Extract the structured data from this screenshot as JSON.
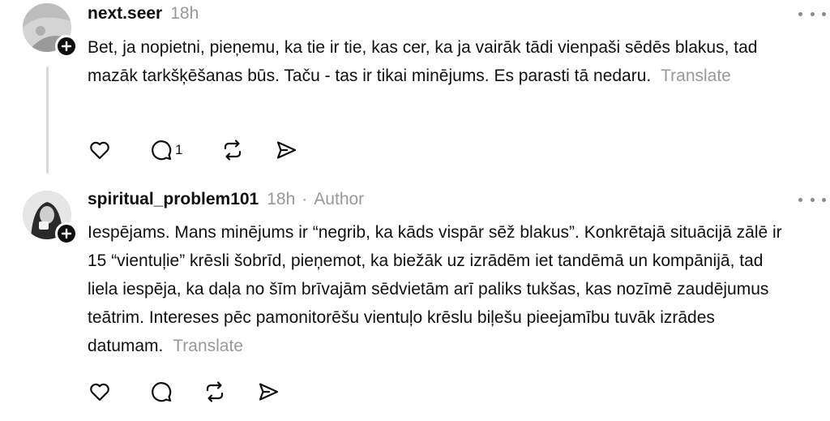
{
  "posts": [
    {
      "username": "next.seer",
      "time": "18h",
      "author_label": "",
      "text": "Bet, ja nopietni, pieņemu, ka tie ir tie, kas cer, ka ja vairāk tādi vienpaši sēdēs blakus, tad mazāk tarkšķēšanas būs. Taču - tas ir tikai minējums. Es parasti tā nedaru.",
      "translate_label": "Translate",
      "reply_count": "1",
      "icons": [
        "heart-icon",
        "comment-icon",
        "repost-icon",
        "share-icon"
      ]
    },
    {
      "username": "spiritual_problem101",
      "time": "18h",
      "author_label": "Author",
      "text": "Iespējams. Mans minējums ir “negrib, ka kāds vispār sēž blakus”. Konkrētajā situācijā zālē ir 15 “vientuļie” krēsli šobrīd, pieņemot, ka biežāk uz izrādēm iet tandēmā un kompānijā, tad liela iespēja, ka daļa no šīm brīvajām sēdvietām arī paliks tukšas, kas nozīmē zaudējumus teātrim. Intereses pēc pamonitorēšu vientuļo krēslu biļešu pieejamību tuvāk izrādes datumam.",
      "translate_label": "Translate",
      "reply_count": "",
      "icons": [
        "heart-icon",
        "comment-icon",
        "repost-icon",
        "share-icon"
      ]
    }
  ],
  "separator": "·"
}
